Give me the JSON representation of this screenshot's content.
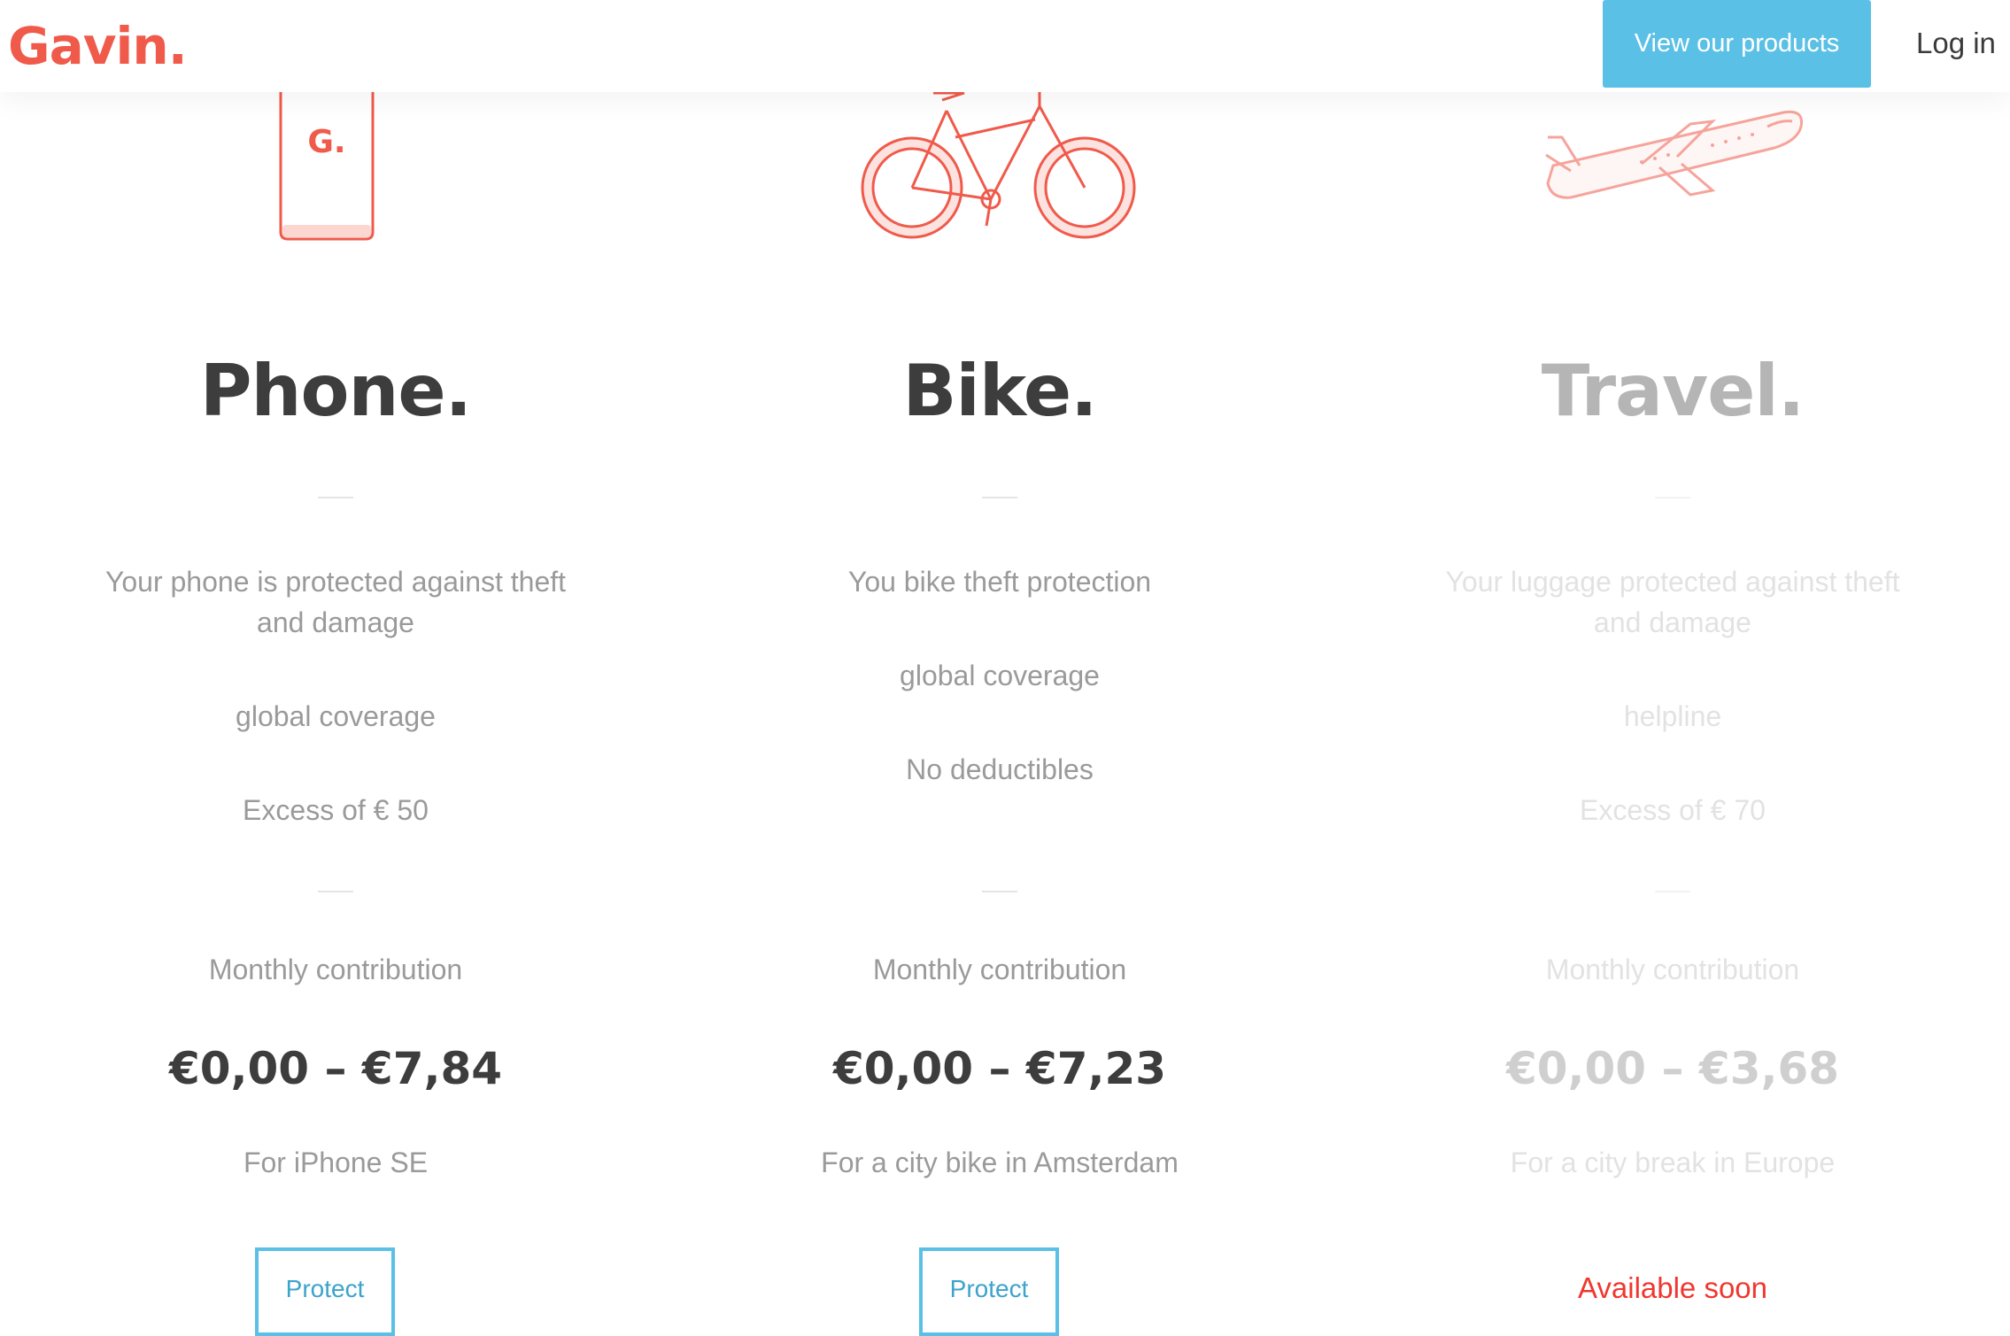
{
  "header": {
    "logo": "Gavin.",
    "products_button": "View our products",
    "login": "Log in"
  },
  "products": [
    {
      "icon": "phone-icon",
      "phone_logo": "G.",
      "title": "Phone.",
      "features": [
        "Your phone is protected against theft and damage",
        "global coverage",
        "Excess of € 50"
      ],
      "monthly_label": "Monthly contribution",
      "price": "€0,00 – €7,84",
      "for": "For iPhone SE",
      "cta": "Protect"
    },
    {
      "icon": "bike-icon",
      "title": "Bike.",
      "features": [
        "You bike theft protection",
        "global coverage",
        "No deductibles"
      ],
      "monthly_label": "Monthly contribution",
      "price": "€0,00 – €7,23",
      "for": "For a city bike in Amsterdam",
      "cta": "Protect"
    },
    {
      "icon": "airplane-icon",
      "title": "Travel.",
      "features": [
        "Your luggage protected against theft and damage",
        "helpline",
        "Excess of € 70"
      ],
      "monthly_label": "Monthly contribution",
      "price": "€0,00 – €3,68",
      "for": "For a city break in Europe",
      "status": "Available soon"
    }
  ],
  "colors": {
    "brand": "#f05a4b",
    "accent": "#5bc0e6",
    "title": "#3d3d3d",
    "muted": "#9a9a9a",
    "available_soon": "#f0372f"
  }
}
